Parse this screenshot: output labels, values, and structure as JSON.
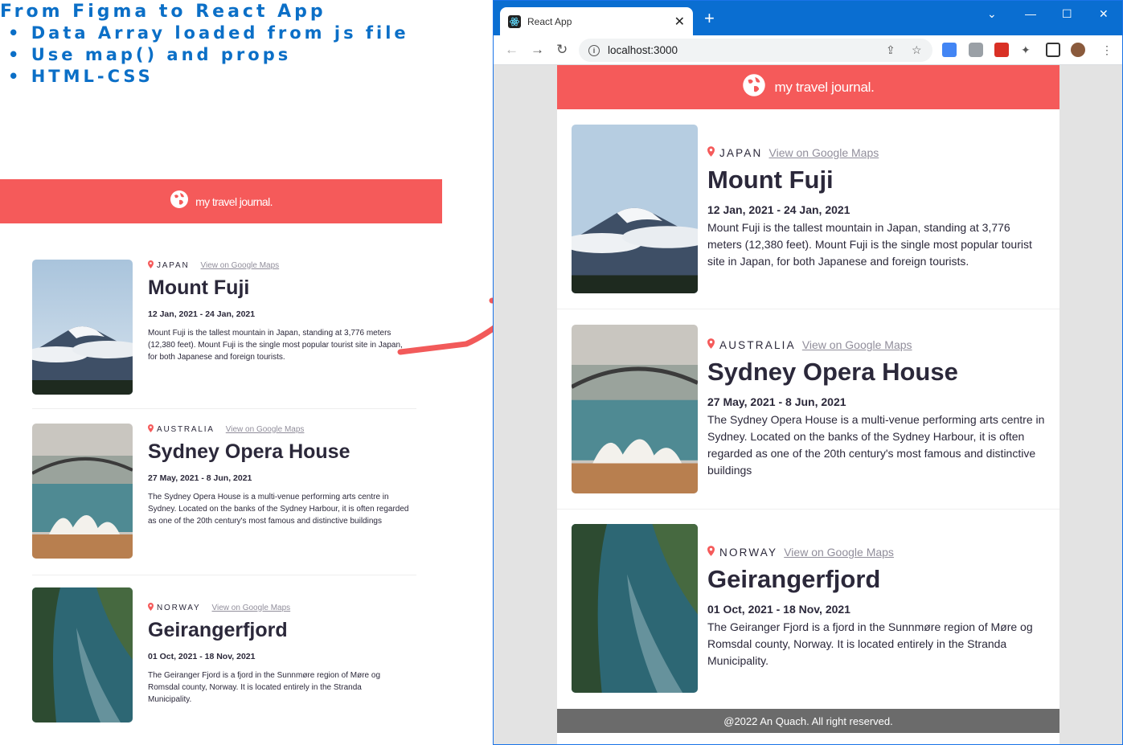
{
  "annotation": {
    "title": "From Figma to React App",
    "bullets": [
      "• Data Array loaded from js file",
      "• Use map() and props",
      "• HTML-CSS"
    ]
  },
  "brand": "my travel journal.",
  "maps_link": "View on Google Maps",
  "trips": [
    {
      "country": "JAPAN",
      "title": "Mount Fuji",
      "dates": "12 Jan, 2021 - 24 Jan, 2021",
      "description": "Mount Fuji is the tallest mountain in Japan, standing at 3,776 meters (12,380 feet). Mount Fuji is the single most popular tourist site in Japan, for both Japanese and foreign tourists.",
      "image": "mount-fuji-photo"
    },
    {
      "country": "AUSTRALIA",
      "title": "Sydney Opera House",
      "dates": "27 May, 2021 - 8 Jun, 2021",
      "description": "The Sydney Opera House is a multi-venue performing arts centre in Sydney. Located on the banks of the Sydney Harbour, it is often regarded as one of the 20th century's most famous and distinctive buildings",
      "image": "sydney-opera-house-photo"
    },
    {
      "country": "NORWAY",
      "title": "Geirangerfjord",
      "dates": "01 Oct, 2021 - 18 Nov, 2021",
      "description": "The Geiranger Fjord is a fjord in the Sunnmøre region of Møre og Romsdal county, Norway. It is located entirely in the Stranda Municipality.",
      "image": "geirangerfjord-photo"
    }
  ],
  "browser": {
    "tab_title": "React App",
    "tab_close": "✕",
    "new_tab": "+",
    "url": "localhost:3000",
    "window_controls": [
      "⌄",
      "—",
      "☐",
      "✕"
    ]
  },
  "footer": "@2022 An Quach. All right reserved.",
  "colors": {
    "accent": "#F55A5A",
    "text": "#2B283A",
    "muted": "#918E9B",
    "footer": "#6B6B6B",
    "annotation": "#0B6FC7",
    "chrome": "#0A6ED1"
  }
}
